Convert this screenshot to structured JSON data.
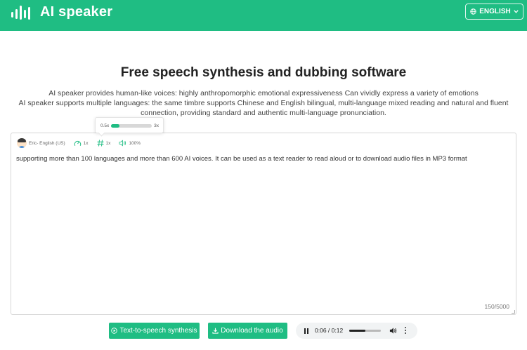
{
  "header": {
    "brand": "AI speaker",
    "language_button": "ENGLISH",
    "logo_icon": "sound-wave-icon",
    "globe_icon": "globe-icon",
    "dropdown_icon": "chevron-down-icon",
    "accent_color": "#1fbd83"
  },
  "main": {
    "title": "Free speech synthesis and dubbing software",
    "description_line1": "AI speaker provides human-like voices: highly anthropomorphic emotional expressiveness Can vividly express a variety of emotions",
    "description_line2": "AI speaker supports multiple languages: the same timbre supports Chinese and English bilingual, multi-language mixed reading and natural and fluent connection, providing standard and authentic multi-language pronunciation."
  },
  "toolbar": {
    "voice": "Eric- English (US)",
    "speed": "1x",
    "pitch": "1x",
    "volume": "100%",
    "speed_icon": "speedometer-icon",
    "pitch_icon": "hash-icon",
    "volume_icon": "speaker-icon"
  },
  "popover": {
    "min": "0.5x",
    "max": "3x",
    "value_fraction": 0.2
  },
  "editor": {
    "text": "supporting more than 100 languages and more than 600 AI voices. It can be used as a text reader to read aloud or to download audio files in MP3 format",
    "counter": "150/5000"
  },
  "actions": {
    "synthesize_label": "Text-to-speech synthesis",
    "download_label": "Download the audio"
  },
  "player": {
    "time": "0:06 / 0:12",
    "progress_fraction": 0.5
  }
}
